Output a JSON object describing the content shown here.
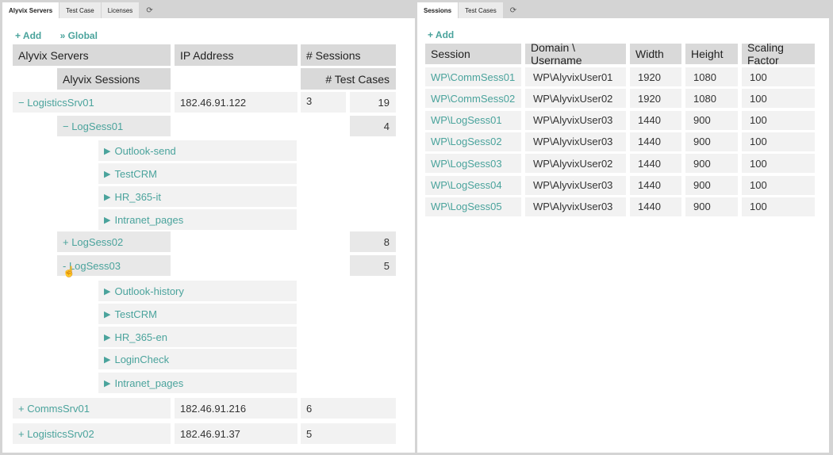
{
  "left_panel": {
    "tabs": [
      {
        "label": "Alyvix Servers",
        "active": true
      },
      {
        "label": "Test Case",
        "active": false
      },
      {
        "label": "Licenses",
        "active": false
      }
    ],
    "refresh_icon": "refresh-icon",
    "actions": {
      "add": "+ Add",
      "global": "» Global"
    },
    "headers": {
      "servers": "Alyvix Servers",
      "ip": "IP Address",
      "sessions": "# Sessions",
      "alyvix_sessions": "Alyvix Sessions",
      "test_cases": "# Test Cases"
    },
    "servers": [
      {
        "name": "− LogisticsSrv01",
        "ip": "182.46.91.122",
        "sessions": "3",
        "test_cases": "19",
        "session_rows": [
          {
            "name": "− LogSess01",
            "test_cases": "4",
            "cases": [
              "Outlook-send",
              "TestCRM",
              "HR_365-it",
              "Intranet_pages"
            ]
          },
          {
            "name": "+ LogSess02",
            "test_cases": "8",
            "cases": []
          },
          {
            "name": "- LogSess03",
            "test_cases": "5",
            "cases": [
              "Outlook-history",
              "TestCRM",
              "HR_365-en",
              "LoginCheck",
              "Intranet_pages"
            ]
          }
        ]
      },
      {
        "name": "+ CommsSrv01",
        "ip": "182.46.91.216",
        "sessions": "6"
      },
      {
        "name": "+ LogisticsSrv02",
        "ip": "182.46.91.37",
        "sessions": "5"
      }
    ]
  },
  "right_panel": {
    "tabs": [
      {
        "label": "Sessions",
        "active": true
      },
      {
        "label": "Test Cases",
        "active": false
      }
    ],
    "refresh_icon": "refresh-icon",
    "actions": {
      "add": "+ Add"
    },
    "columns": [
      "Session",
      "Domain \\ Username",
      "Width",
      "Height",
      "Scaling Factor"
    ],
    "rows": [
      [
        "WP\\CommSess01",
        "WP\\AlyvixUser01",
        "1920",
        "1080",
        "100"
      ],
      [
        "WP\\CommSess02",
        "WP\\AlyvixUser02",
        "1920",
        "1080",
        "100"
      ],
      [
        "WP\\LogSess01",
        "WP\\AlyvixUser03",
        "1440",
        "900",
        "100"
      ],
      [
        "WP\\LogSess02",
        "WP\\AlyvixUser03",
        "1440",
        "900",
        "100"
      ],
      [
        "WP\\LogSess03",
        "WP\\AlyvixUser02",
        "1440",
        "900",
        "100"
      ],
      [
        "WP\\LogSess04",
        "WP\\AlyvixUser03",
        "1440",
        "900",
        "100"
      ],
      [
        "WP\\LogSess05",
        "WP\\AlyvixUser03",
        "1440",
        "900",
        "100"
      ]
    ]
  },
  "colors": {
    "accent": "#4aa39c",
    "header_bg": "#d9d9d9",
    "cell_bg": "#f2f2f2",
    "frame_bg": "#d4d4d4"
  }
}
